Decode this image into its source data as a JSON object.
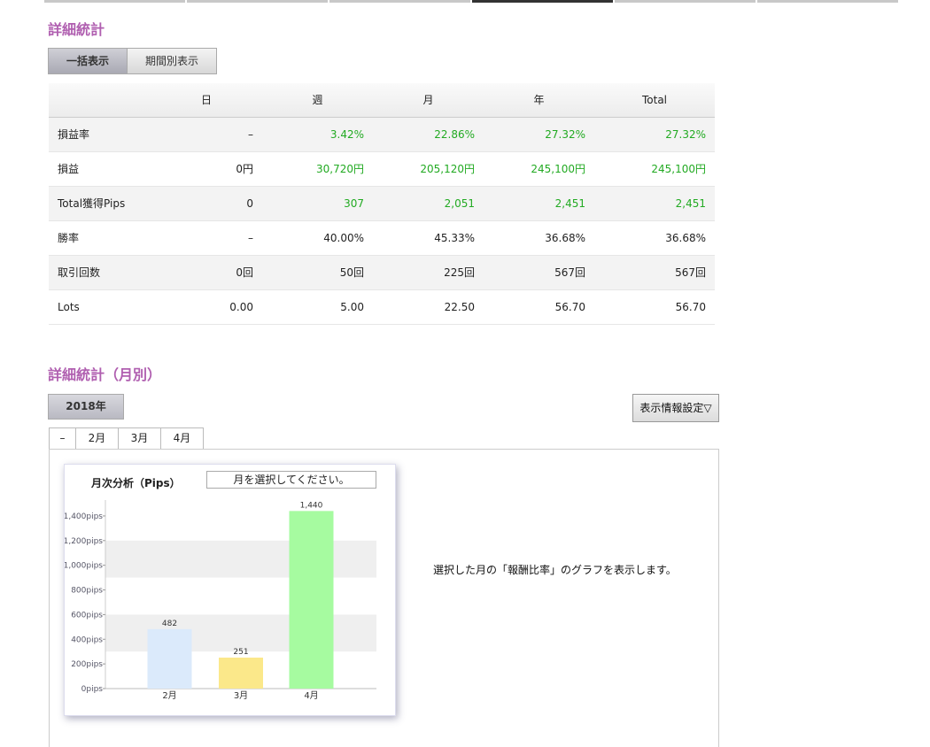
{
  "section1": {
    "title": "詳細統計"
  },
  "view_toggle": {
    "all_label": "一括表示",
    "period_label": "期間別表示"
  },
  "stats_table": {
    "headers": [
      "",
      "日",
      "週",
      "月",
      "年",
      "Total"
    ],
    "rows": [
      {
        "label": "損益率",
        "values": [
          "–",
          "3.42%",
          "22.86%",
          "27.32%",
          "27.32%"
        ],
        "green": [
          false,
          true,
          true,
          true,
          true
        ]
      },
      {
        "label": "損益",
        "values": [
          "0円",
          "30,720円",
          "205,120円",
          "245,100円",
          "245,100円"
        ],
        "green": [
          false,
          true,
          true,
          true,
          true
        ]
      },
      {
        "label": "Total獲得Pips",
        "values": [
          "0",
          "307",
          "2,051",
          "2,451",
          "2,451"
        ],
        "green": [
          false,
          true,
          true,
          true,
          true
        ]
      },
      {
        "label": "勝率",
        "values": [
          "–",
          "40.00%",
          "45.33%",
          "36.68%",
          "36.68%"
        ],
        "green": [
          false,
          false,
          false,
          false,
          false
        ]
      },
      {
        "label": "取引回数",
        "values": [
          "0回",
          "50回",
          "225回",
          "567回",
          "567回"
        ],
        "green": [
          false,
          false,
          false,
          false,
          false
        ]
      },
      {
        "label": "Lots",
        "values": [
          "0.00",
          "5.00",
          "22.50",
          "56.70",
          "56.70"
        ],
        "green": [
          false,
          false,
          false,
          false,
          false
        ]
      }
    ]
  },
  "section2": {
    "title": "詳細統計（月別）"
  },
  "year_button": {
    "label": "2018年"
  },
  "settings_button": {
    "label": "表示情報設定▽"
  },
  "month_tabs": [
    "–",
    "2月",
    "3月",
    "4月"
  ],
  "chart_panel": {
    "title": "月次分析（Pips）",
    "select_placeholder": "月を選択してください。",
    "info_text": "選択した月の「報酬比率」のグラフを表示します。"
  },
  "colors": {
    "title": "#b05fb0",
    "positive": "#22aa22"
  },
  "chart_data": {
    "type": "bar",
    "title": "月次分析（Pips）",
    "categories": [
      "2月",
      "3月",
      "4月"
    ],
    "values": [
      482,
      251,
      1440
    ],
    "value_labels": [
      "482",
      "251",
      "1,440"
    ],
    "bar_colors": [
      "#dbeafb",
      "#fbe88a",
      "#a6fba0"
    ],
    "ylim": [
      0,
      1500
    ],
    "yticks": [
      0,
      200,
      400,
      600,
      800,
      1000,
      1200,
      1400
    ],
    "ytick_labels": [
      "0pips",
      "200pips",
      "400pips",
      "600pips",
      "800pips",
      "1,000pips",
      "1,200pips",
      "1,400pips"
    ],
    "band_ranges": [
      [
        300,
        600
      ],
      [
        900,
        1200
      ]
    ],
    "band_color": "#efefef"
  }
}
